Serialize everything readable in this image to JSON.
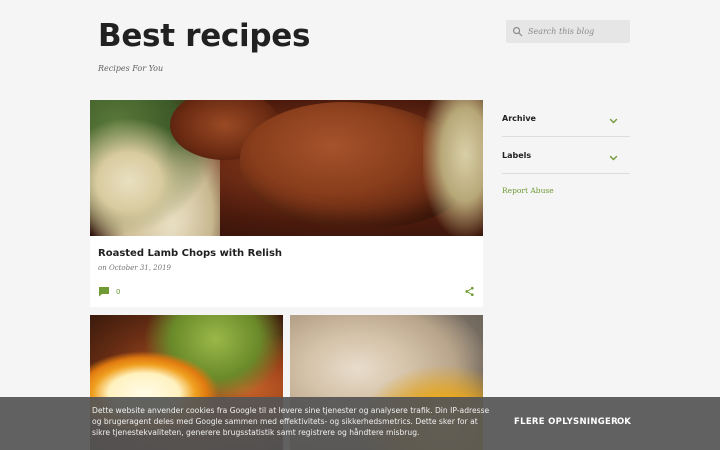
{
  "header": {
    "title": "Best recipes",
    "description": "Recipes For You"
  },
  "search": {
    "placeholder": "Search this blog",
    "icon": "search-icon"
  },
  "sidebar": {
    "widgets": [
      {
        "label": "Archive",
        "icon": "chevron-down-icon"
      },
      {
        "label": "Labels",
        "icon": "chevron-down-icon"
      }
    ],
    "report_abuse": "Report Abuse"
  },
  "posts": [
    {
      "title": "Roasted Lamb Chops with Relish",
      "date": "on October 31, 2019",
      "comments": "0"
    }
  ],
  "cookie_notice": {
    "text": "Dette website anvender cookies fra Google til at levere sine tjenester og analysere trafik. Din IP-adresse og brugeragent deles med Google sammen med effektivitets- og sikkerhedsmetrics. Dette sker for at sikre tjenestekvaliteten, generere brugsstatistik samt registrere og håndtere misbrug.",
    "more_label": "FLERE OPLYSNINGER",
    "ok_label": "OK"
  },
  "colors": {
    "background": "#f5f5f5",
    "accent": "#6f9a35",
    "title": "#212121",
    "cookie_bar": "#555555"
  }
}
